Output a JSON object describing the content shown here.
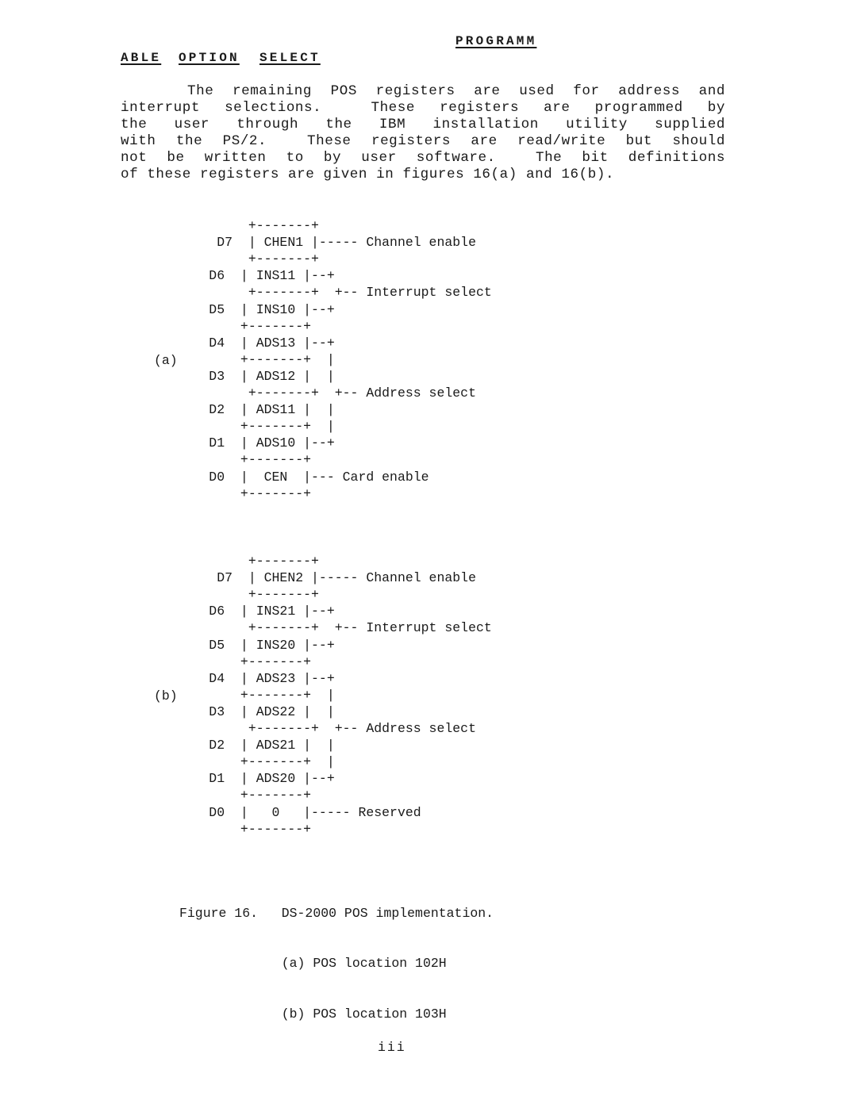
{
  "header": {
    "line1": "PROGRAMM",
    "line2_words": [
      "ABLE",
      "OPTION",
      "SELECT"
    ]
  },
  "paragraph": {
    "lines": [
      "The remaining POS registers are used for address and",
      "interrupt selections.  These registers are programmed by",
      "the user through the IBM installation utility supplied",
      "with the PS/2.  These registers are read/write but should",
      "not be written to by user software.  The bit definitions",
      "of these registers are given in figures 16(a) and 16(b)."
    ]
  },
  "figure_a": {
    "label": "(a)",
    "lines": [
      "            +-------+",
      "        D7  | CHEN1 |----- Channel enable",
      "            +-------+",
      "       D6  | INS11 |--+",
      "            +-------+  +-- Interrupt select",
      "       D5  | INS10 |--+",
      "           +-------+",
      "       D4  | ADS13 |--+",
      "           +-------+  |",
      "       D3  | ADS12 |  |",
      "            +-------+  +-- Address select",
      "       D2  | ADS11 |  |",
      "           +-------+  |",
      "       D1  | ADS10 |--+",
      "           +-------+",
      "       D0  |  CEN  |--- Card enable",
      "           +-------+"
    ]
  },
  "figure_b": {
    "label": "(b)",
    "lines": [
      "            +-------+",
      "        D7  | CHEN2 |----- Channel enable",
      "            +-------+",
      "       D6  | INS21 |--+",
      "            +-------+  +-- Interrupt select",
      "       D5  | INS20 |--+",
      "           +-------+",
      "       D4  | ADS23 |--+",
      "           +-------+  |",
      "       D3  | ADS22 |  |",
      "            +-------+  +-- Address select",
      "       D2  | ADS21 |  |",
      "           +-------+  |",
      "       D1  | ADS20 |--+",
      "           +-------+",
      "       D0  |   0   |----- Reserved",
      "           +-------+"
    ]
  },
  "caption": {
    "lines": [
      "Figure 16.   DS-2000 POS implementation.",
      "             (a) POS location 102H",
      "             (b) POS location 103H"
    ]
  },
  "page_number": "iii"
}
